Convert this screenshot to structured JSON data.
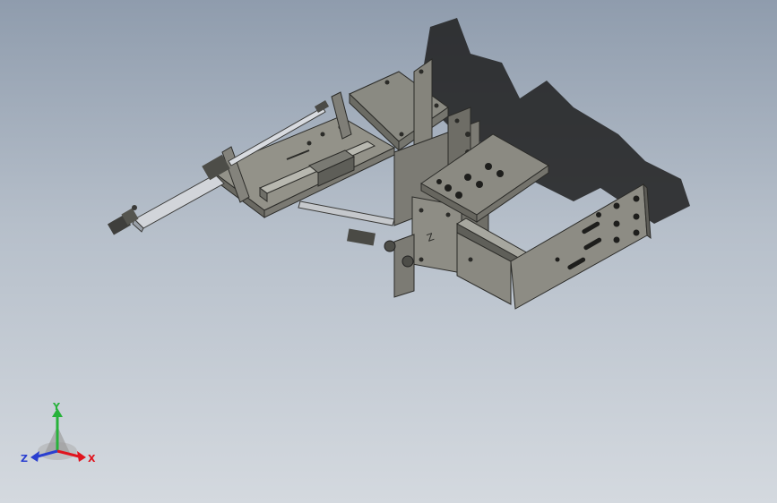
{
  "viewport": {
    "background_top": "#8f9cad",
    "background_bottom": "#d4d9df"
  },
  "model": {
    "part_color": "#8d8c83",
    "part_shadow_color": "#5c5b55",
    "rod_color": "#d8dbe0",
    "drop_shadow_color": "#2a2a2a"
  },
  "triad": {
    "x_label": "X",
    "y_label": "Y",
    "z_label": "Z",
    "x_color": "#e0141e",
    "y_color": "#27b23a",
    "z_color": "#2a3fd0"
  }
}
